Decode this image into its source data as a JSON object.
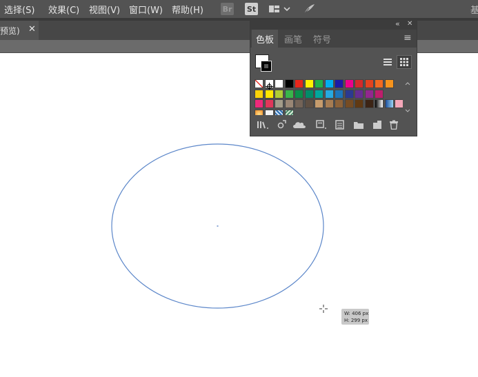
{
  "menu": {
    "items": [
      "选择(S)",
      "效果(C)",
      "视图(V)",
      "窗口(W)",
      "帮助(H)"
    ],
    "bridge_label": "Br",
    "stock_label": "St",
    "right_clip": "基"
  },
  "document_tab": {
    "label": "预览)",
    "close": "✕"
  },
  "swatches_panel": {
    "tabs": [
      "色板",
      "画笔",
      "符号"
    ],
    "active_tab": "色板",
    "collapse_glyph": "«",
    "close_glyph": "✕",
    "menu_glyph": "≡",
    "swatch_rows": [
      [
        "none",
        "register",
        "#ffffff",
        "#000000",
        "#e8261b",
        "#fff200",
        "#20b14a",
        "#00aeef",
        "#1a1aa6",
        "#ec008c",
        "#d42a2a",
        "#e3431f",
        "#f26a21",
        "#f7941d"
      ],
      [
        "#fbd208",
        "#ffe600",
        "#b0cc35",
        "#39b54a",
        "#0a8f4a",
        "#008c69",
        "#00a79d",
        "#27a9e1",
        "#1c75bc",
        "#2b3990",
        "#662d91",
        "#92278f",
        "#be1e6c"
      ],
      [
        "#ee2a7b",
        "#e0375a",
        "#a39c8a",
        "#998675",
        "#736357",
        "#5e4f43",
        "#c69c6d",
        "#a67c52",
        "#8c6239",
        "#754c24",
        "#603913",
        "#3c2415",
        "gradient-bw",
        "gradient-blue",
        "#f4a7b9"
      ],
      [
        "gradient-orange",
        "#f3f3f3",
        "pattern-blue",
        "pattern-green"
      ]
    ]
  },
  "cursor_tooltip": {
    "width": "W: 406 px",
    "height": "H: 299 px"
  },
  "colors": {
    "menubar": "#535353",
    "panel": "#535353",
    "ellipse_stroke": "#5b86c9"
  }
}
